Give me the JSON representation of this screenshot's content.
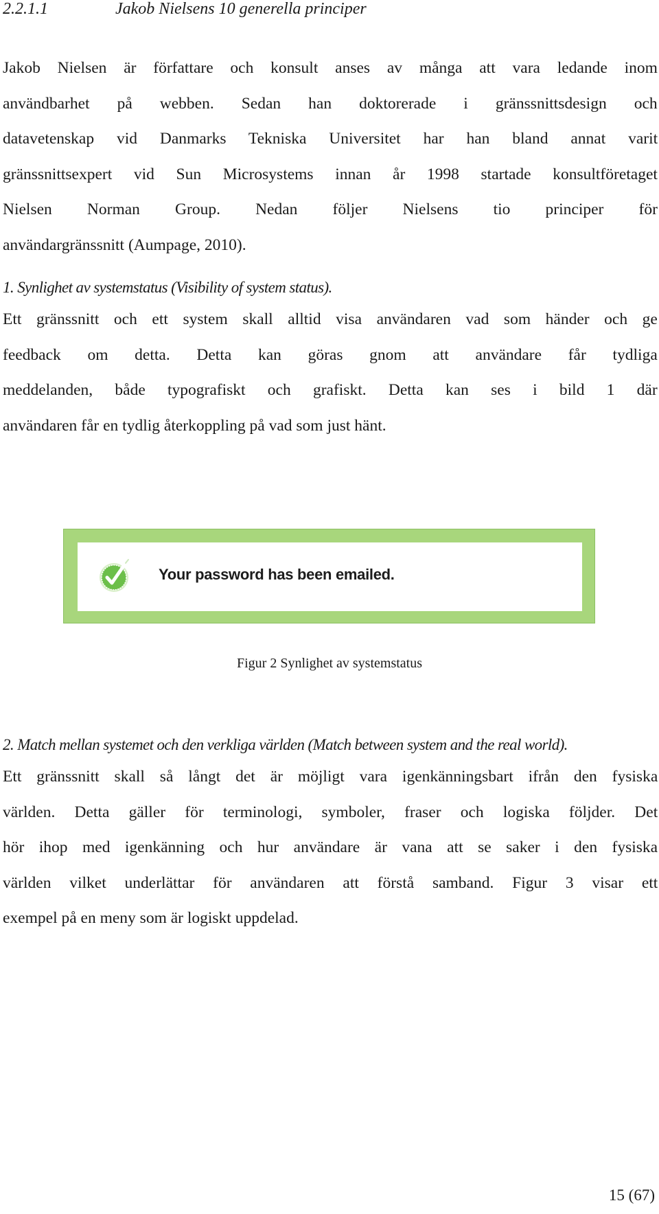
{
  "heading": {
    "number": "2.2.1.1",
    "title": "Jakob Nielsens 10 generella principer"
  },
  "intro": {
    "lines": [
      "Jakob Nielsen är författare och konsult anses av många att vara ledande inom",
      "användbarhet på webben. Sedan han doktorerade i gränssnittsdesign och",
      "datavetenskap vid Danmarks Tekniska Universitet har han bland annat varit",
      "gränssnittsexpert vid Sun Microsystems innan år 1998 startade konsultföretaget",
      "Nielsen Norman Group. Nedan följer Nielsens tio principer för",
      "användargränssnitt (Aumpage, 2010)."
    ]
  },
  "principle1": {
    "title": "1. Synlighet av systemstatus (Visibility of system status).",
    "lines": [
      "Ett gränssnitt och ett system skall alltid visa användaren vad som händer och ge",
      "feedback om detta. Detta kan göras gnom att användare får tydliga",
      "meddelanden, både typografiskt och grafiskt. Detta kan ses i bild 1 där",
      "användaren får en tydlig återkoppling på vad som just hänt."
    ]
  },
  "figure": {
    "message": "Your password has been emailed.",
    "icon": "checkmark-circle-icon",
    "frame_color": "#a8d67c",
    "icon_color": "#6cbf4a",
    "caption": "Figur 2 Synlighet av systemstatus"
  },
  "principle2": {
    "title": "2. Match mellan systemet och den verkliga världen (Match between system and the real world).",
    "lines": [
      "Ett gränssnitt skall så långt det är möjligt vara igenkänningsbart ifrån den fysiska",
      "världen. Detta gäller för terminologi, symboler, fraser och logiska följder. Det",
      "hör ihop med igenkänning och hur användare är vana att se saker i den fysiska",
      "världen vilket underlättar för användaren att förstå samband. Figur 3 visar ett",
      "exempel på en meny som är logiskt uppdelad."
    ]
  },
  "footer": {
    "page_number": "15 (67)"
  }
}
